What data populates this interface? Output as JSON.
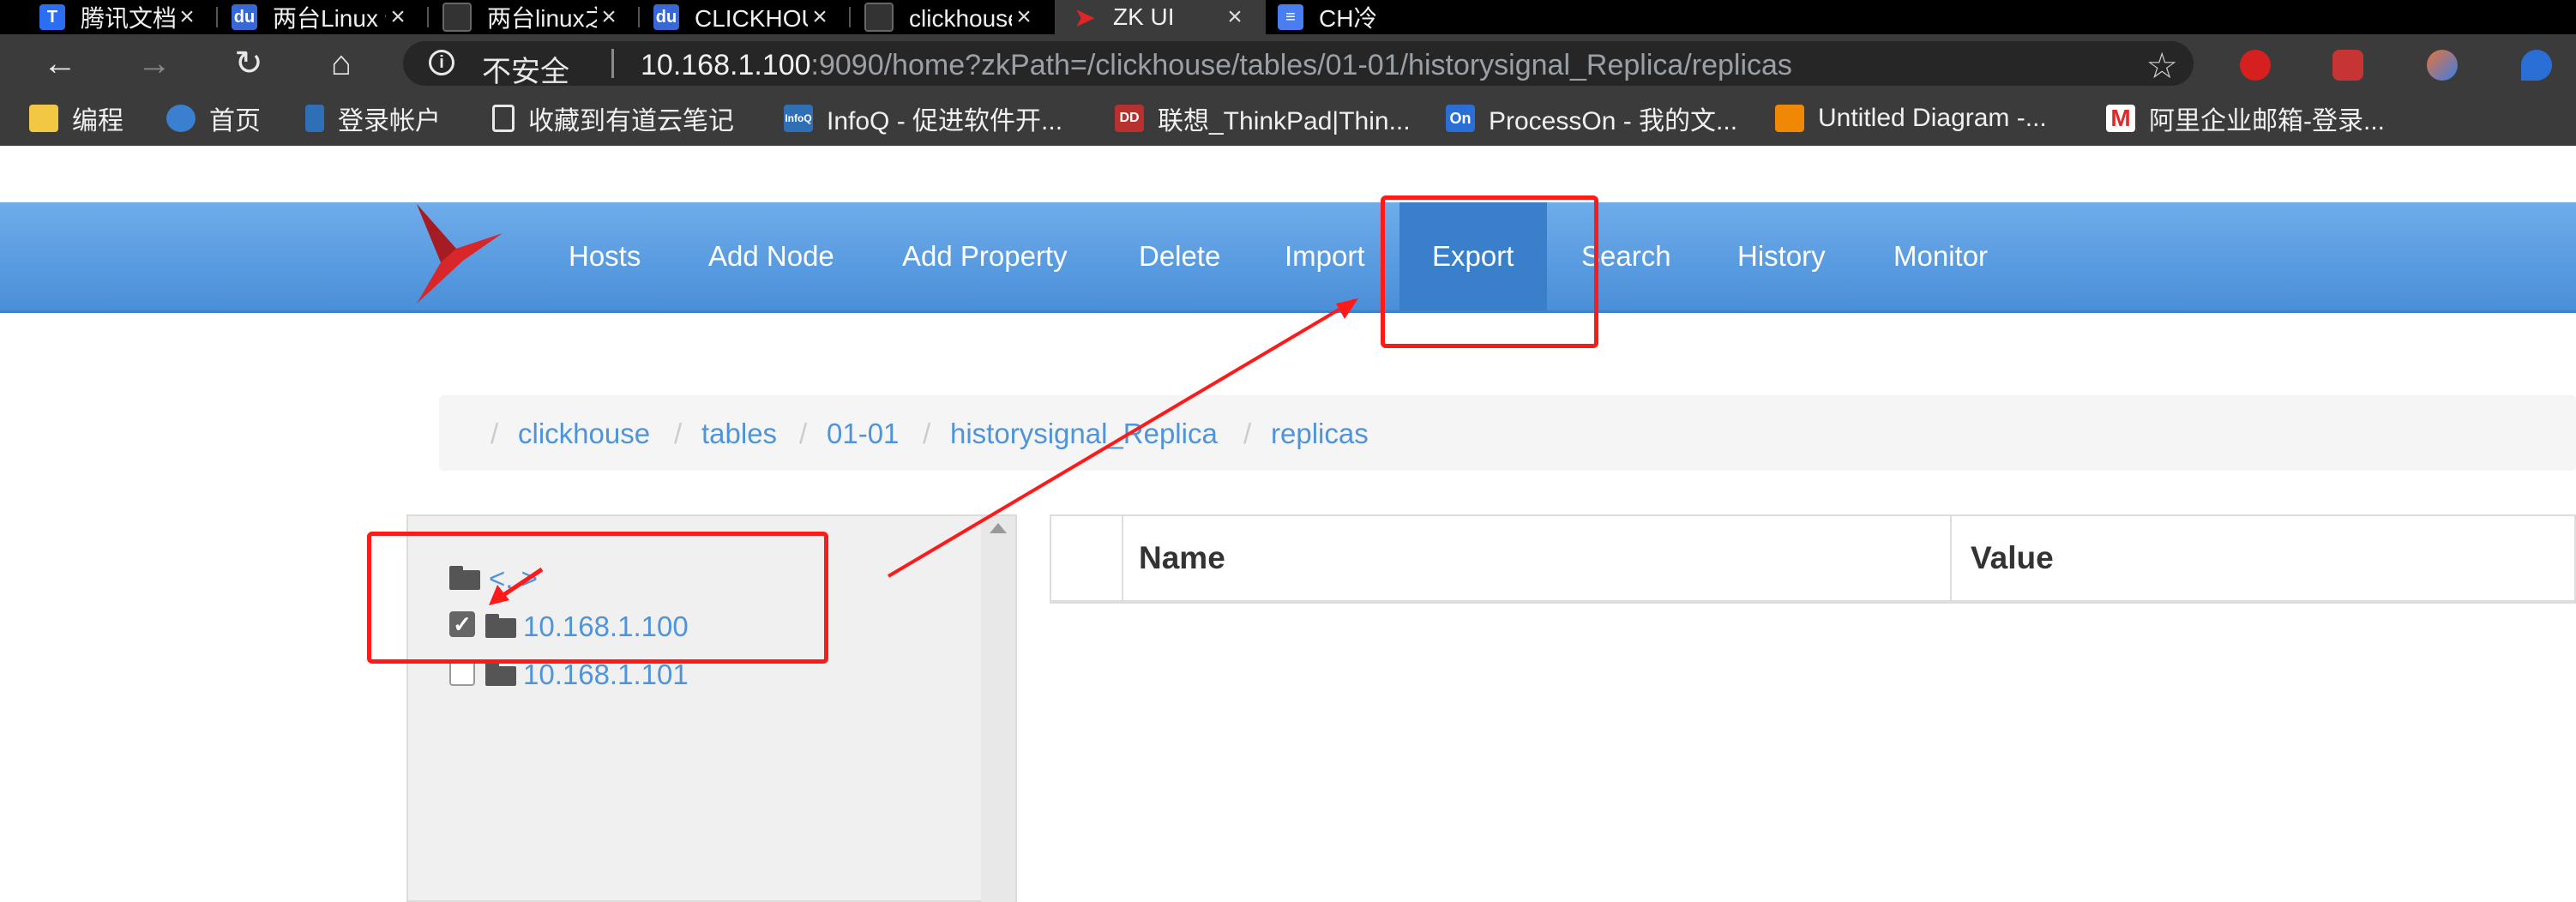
{
  "browser": {
    "tabs": [
      {
        "title": "腾讯文档",
        "favicon_color": "#2b6ef2",
        "active": false
      },
      {
        "title": "两台Linux 传输数据_百",
        "favicon_color": "#3867d6",
        "active": false
      },
      {
        "title": "两台linux之间传输文件",
        "favicon_color": "#666666",
        "active": false
      },
      {
        "title": "CLICKHOUSE 修改时区",
        "favicon_color": "#3867d6",
        "active": false
      },
      {
        "title": "clickhouse修改时区 - 快",
        "favicon_color": "#666666",
        "active": false
      },
      {
        "title": "ZK UI",
        "favicon_color": "#d22",
        "active": true
      },
      {
        "title": "CH冷溶",
        "favicon_color": "#4a7df0",
        "active": false
      }
    ],
    "address": {
      "security_label": "不安全",
      "host": "10.168.1.100",
      "rest": ":9090/home?zkPath=/clickhouse/tables/01-01/historysignal_Replica/replicas"
    },
    "bookmarks": [
      {
        "label": "编程",
        "icon": "folder-icon",
        "color": "#f2c744"
      },
      {
        "label": "首页",
        "icon": "swirl-icon",
        "color": "#3b7fd1"
      },
      {
        "label": "登录帐户",
        "icon": "leaf-icon",
        "color": "#2f6fb6"
      },
      {
        "label": "收藏到有道云笔记",
        "icon": "page-icon",
        "color": "#e8e8e8"
      },
      {
        "label": "InfoQ - 促进软件开...",
        "icon": "infoq-icon",
        "color": "#2f6fb6"
      },
      {
        "label": "联想_ThinkPad|Thin...",
        "icon": "lenovo-icon",
        "color": "#b8312f"
      },
      {
        "label": "ProcessOn - 我的文...",
        "icon": "processon-icon",
        "color": "#2a6fd6"
      },
      {
        "label": "Untitled Diagram -...",
        "icon": "drawio-icon",
        "color": "#f08705"
      },
      {
        "label": "阿里企业邮箱-登录...",
        "icon": "mail-icon",
        "color": "#e02a2a"
      }
    ]
  },
  "app": {
    "nav": [
      "Hosts",
      "Add Node",
      "Add Property",
      "Delete",
      "Import",
      "Export",
      "Search",
      "History",
      "Monitor"
    ],
    "active_nav": "Export",
    "breadcrumb": [
      "clickhouse",
      "tables",
      "01-01",
      "historysignal_Replica",
      "replicas"
    ],
    "tree": {
      "parent_label": "<..>",
      "items": [
        {
          "label": "10.168.1.100",
          "checked": true
        },
        {
          "label": "10.168.1.101",
          "checked": false
        }
      ]
    },
    "table": {
      "headers": [
        "Name",
        "Value"
      ]
    }
  },
  "colors": {
    "accent_blue": "#4a8fd9",
    "link_blue": "#4f94d8",
    "annotation_red": "#ff1a1a"
  }
}
